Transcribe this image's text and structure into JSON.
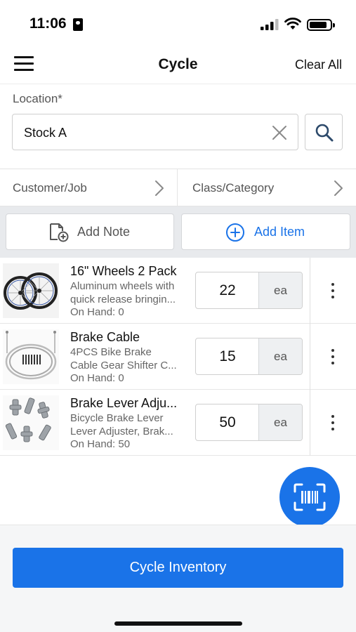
{
  "status_bar": {
    "time": "11:06"
  },
  "header": {
    "title": "Cycle",
    "clear_all": "Clear All"
  },
  "location": {
    "label": "Location*",
    "value": "Stock A"
  },
  "selectors": {
    "customer_job": "Customer/Job",
    "class_category": "Class/Category"
  },
  "actions": {
    "add_note": "Add Note",
    "add_item": "Add Item"
  },
  "items": [
    {
      "name": "16\" Wheels 2 Pack",
      "desc_line1": "Aluminum wheels with",
      "desc_line2": "quick release bringin...",
      "on_hand": "On Hand: 0",
      "qty": "22",
      "unit": "ea",
      "thumb_icon": "bike-wheels-image"
    },
    {
      "name": "Brake Cable",
      "desc_line1": "4PCS Bike Brake",
      "desc_line2": "Cable Gear Shifter C...",
      "on_hand": "On Hand: 0",
      "qty": "15",
      "unit": "ea",
      "thumb_icon": "brake-cable-image"
    },
    {
      "name": "Brake Lever Adju...",
      "desc_line1": "Bicycle Brake Lever",
      "desc_line2": "Lever Adjuster, Brak...",
      "on_hand": "On Hand: 50",
      "qty": "50",
      "unit": "ea",
      "thumb_icon": "lever-adjuster-image"
    }
  ],
  "footer": {
    "cycle_button": "Cycle Inventory"
  },
  "colors": {
    "accent": "#1a73e8",
    "action_bg": "#e8eaed"
  }
}
